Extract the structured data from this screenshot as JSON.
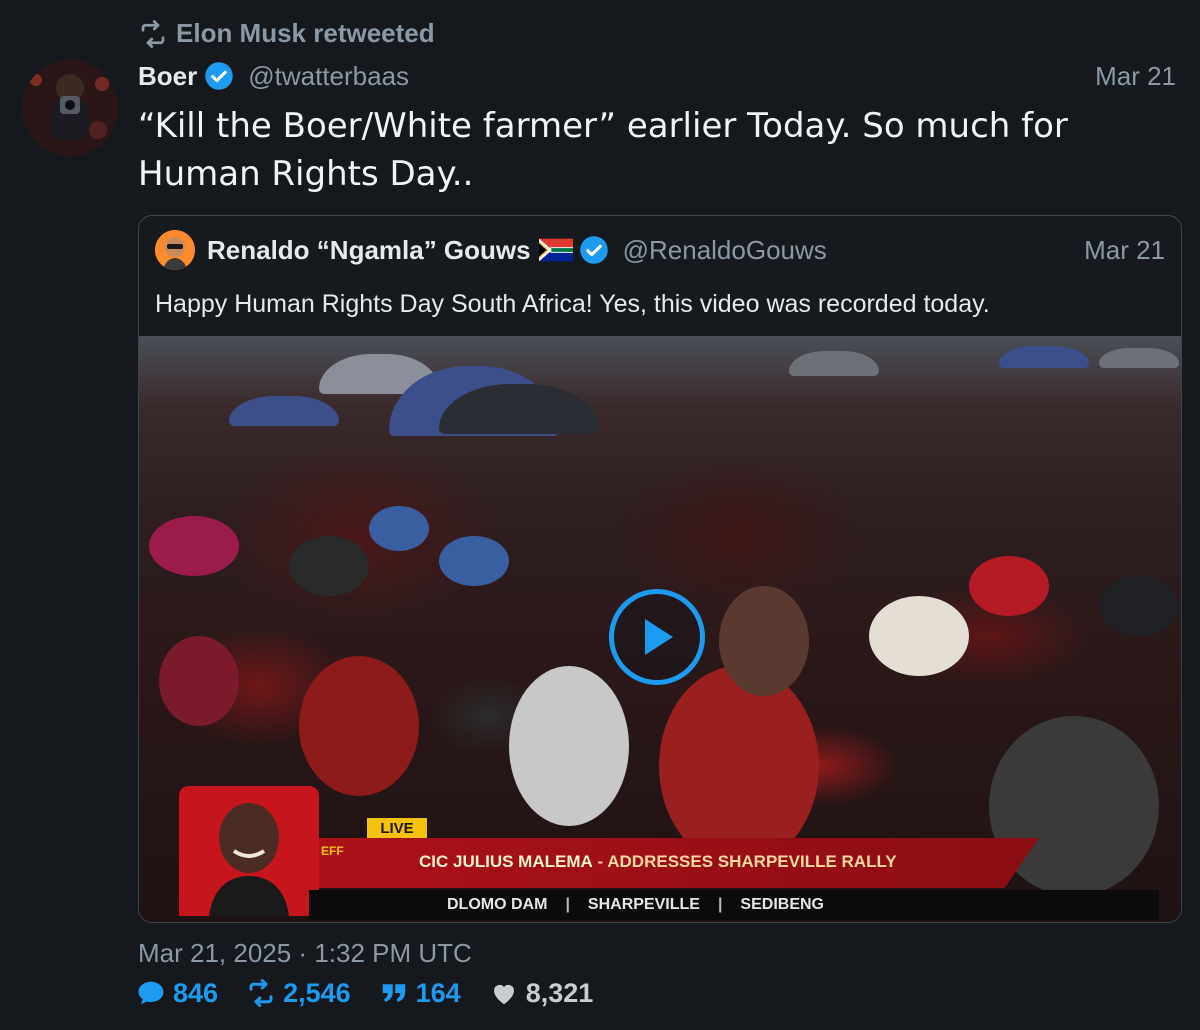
{
  "retweet": {
    "text": "Elon Musk retweeted"
  },
  "tweet": {
    "author_name": "Boer",
    "handle": "@twatterbaas",
    "date": "Mar 21",
    "text_line1": "“Kill the Boer/White farmer” earlier Today. So much for",
    "text_line2": "Human Rights Day.."
  },
  "quote": {
    "author_name": "Renaldo “Ngamla” Gouws",
    "flag": "🇿🇦",
    "handle": "@RenaldoGouws",
    "date": "Mar 21",
    "text": "Happy Human Rights Day South Africa! Yes, this video was recorded today.",
    "video": {
      "live_label": "LIVE",
      "headline_name": "CIC JULIUS MALEMA",
      "headline_rest": " - ADDRESSES SHARPEVILLE RALLY",
      "location_parts": [
        "DLOMO DAM",
        "SHARPEVILLE",
        "SEDIBENG"
      ],
      "separator": "|",
      "party_label": "EFF"
    }
  },
  "footer": {
    "timestamp": "Mar 21, 2025 · 1:32 PM UTC",
    "replies": "846",
    "retweets": "2,546",
    "quotes": "164",
    "likes": "8,321"
  },
  "colors": {
    "accent": "#1d9bf0",
    "background": "#15181c",
    "muted": "#8b98a5"
  }
}
